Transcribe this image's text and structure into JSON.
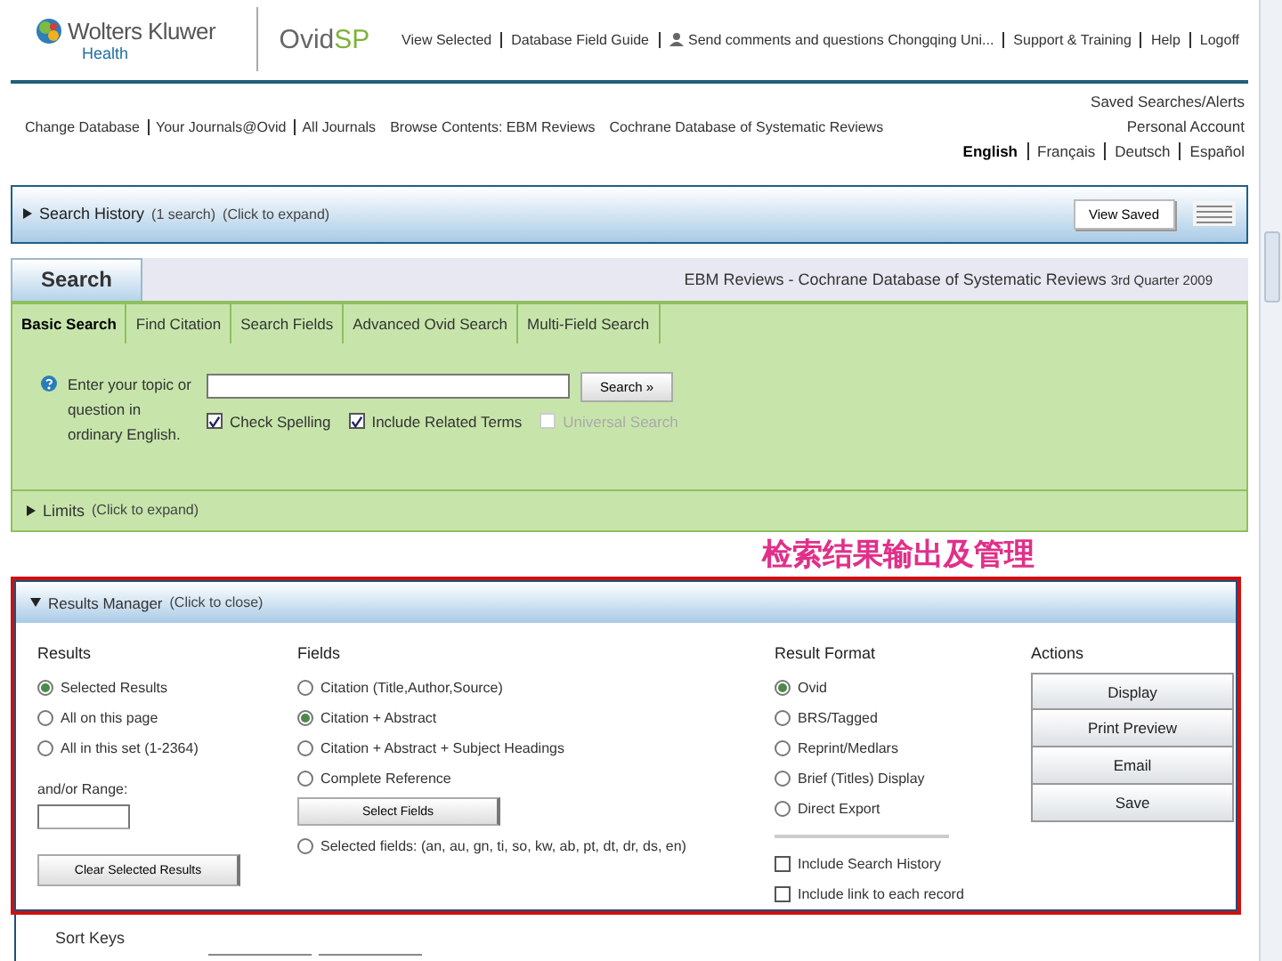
{
  "header": {
    "brand": "Wolters Kluwer",
    "brand_sub": "Health",
    "product": {
      "name": "Ovid",
      "suffix": "SP"
    },
    "top_links": [
      {
        "label": "View Selected",
        "kind": "link"
      },
      {
        "label": "Database Field Guide",
        "kind": "link"
      },
      {
        "label": "Send comments and questions Chongqing Uni...",
        "kind": "icon-link"
      },
      {
        "label": "Support & Training",
        "kind": "link"
      },
      {
        "label": "Help",
        "kind": "link"
      },
      {
        "label": "Logoff",
        "kind": "link"
      }
    ]
  },
  "nav_links": [
    "Change Database",
    "Your Journals@Ovid",
    "All Journals",
    "Browse Contents: EBM Reviews",
    "Cochrane Database of Systematic Reviews"
  ],
  "account_links": [
    "Saved Searches/Alerts",
    "Personal Account"
  ],
  "languages": [
    {
      "label": "English",
      "selected": true
    },
    {
      "label": "Français",
      "selected": false
    },
    {
      "label": "Deutsch",
      "selected": false
    },
    {
      "label": "Español",
      "selected": false
    }
  ],
  "search_history": {
    "title": "Search History",
    "count": "(1 search)",
    "hint": "(Click to expand)",
    "button": "View Saved"
  },
  "search": {
    "tab": "Search",
    "database": "EBM Reviews - Cochrane Database of Systematic Reviews",
    "edition": "3rd Quarter 2009",
    "subtabs": [
      {
        "label": "Basic Search",
        "selected": true
      },
      {
        "label": "Find Citation",
        "selected": false
      },
      {
        "label": "Search Fields",
        "selected": false
      },
      {
        "label": "Advanced Ovid Search",
        "selected": false
      },
      {
        "label": "Multi-Field Search",
        "selected": false
      }
    ],
    "prompt": "Enter your topic or question in ordinary English.",
    "button": "Search »",
    "options": [
      {
        "label": "Check Spelling",
        "checked": true,
        "disabled": false
      },
      {
        "label": "Include Related Terms",
        "checked": true,
        "disabled": false
      },
      {
        "label": "Universal Search",
        "checked": false,
        "disabled": true
      }
    ],
    "limits": {
      "title": "Limits",
      "hint": "(Click to expand)"
    }
  },
  "annotation": "检索结果输出及管理",
  "results_manager": {
    "title": "Results Manager",
    "hint": "(Click to close)",
    "results": {
      "heading": "Results",
      "options": [
        {
          "label": "Selected Results",
          "selected": true
        },
        {
          "label": "All on this page",
          "selected": false
        },
        {
          "label": "All in this set (1-2364)",
          "selected": false
        }
      ],
      "range_label": "and/or Range:",
      "clear_button": "Clear Selected Results"
    },
    "fields": {
      "heading": "Fields",
      "options": [
        {
          "label": "Citation (Title,Author,Source)",
          "selected": false
        },
        {
          "label": "Citation + Abstract",
          "selected": true
        },
        {
          "label": "Citation + Abstract + Subject Headings",
          "selected": false
        },
        {
          "label": "Complete Reference",
          "selected": false
        }
      ],
      "select_button": "Select Fields",
      "custom_option": {
        "label": "Selected fields: (an, au, gn, ti, so, kw, ab, pt, dt, dr, ds, en)",
        "selected": false
      }
    },
    "format": {
      "heading": "Result Format",
      "options": [
        {
          "label": "Ovid",
          "selected": true
        },
        {
          "label": "BRS/Tagged",
          "selected": false
        },
        {
          "label": "Reprint/Medlars",
          "selected": false
        },
        {
          "label": "Brief (Titles) Display",
          "selected": false
        },
        {
          "label": "Direct Export",
          "selected": false
        }
      ],
      "includes": [
        {
          "label": "Include Search History",
          "checked": false
        },
        {
          "label": "Include link to each record",
          "checked": false
        }
      ]
    },
    "actions": {
      "heading": "Actions",
      "buttons": [
        "Display",
        "Print Preview",
        "Email",
        "Save"
      ]
    }
  },
  "sort_keys": {
    "heading": "Sort Keys"
  }
}
